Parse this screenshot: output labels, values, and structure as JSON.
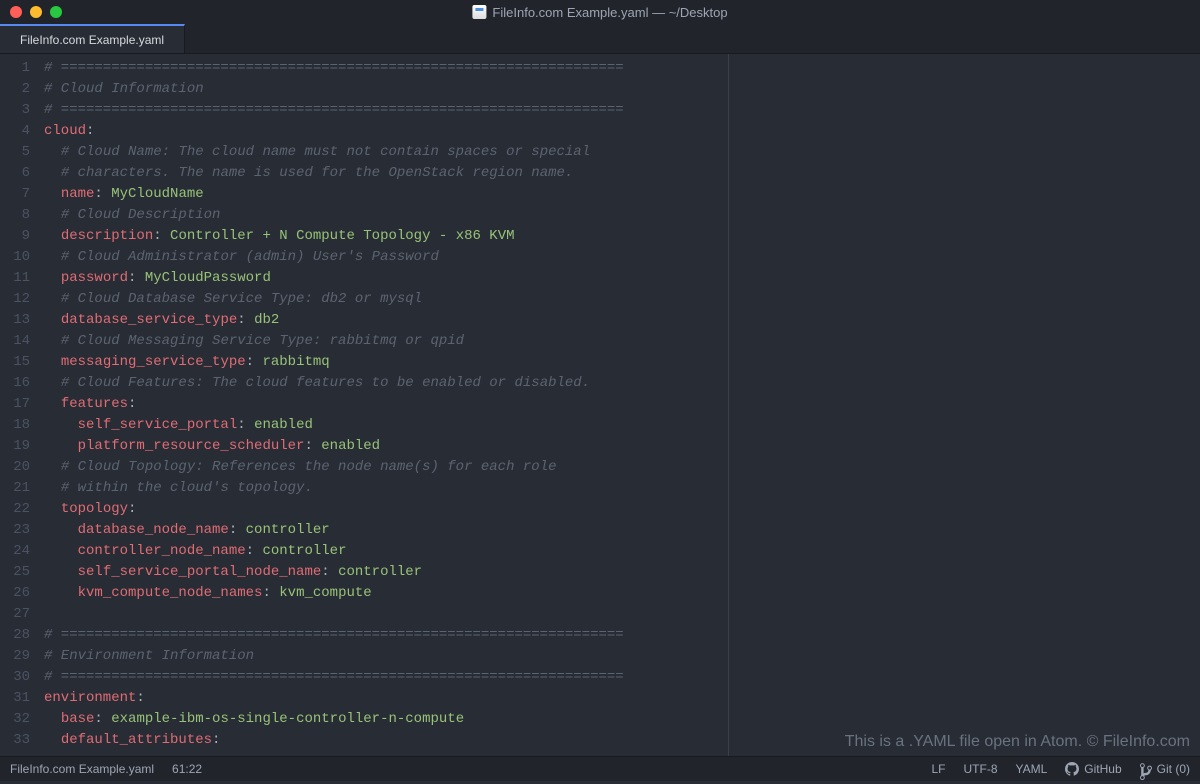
{
  "titlebar": {
    "title": "FileInfo.com Example.yaml — ~/Desktop"
  },
  "tab": {
    "label": "FileInfo.com Example.yaml"
  },
  "code": {
    "lines": [
      {
        "n": 1,
        "spans": [
          {
            "cls": "comment",
            "t": "# ==================================================================="
          }
        ]
      },
      {
        "n": 2,
        "spans": [
          {
            "cls": "comment",
            "t": "# Cloud Information"
          }
        ]
      },
      {
        "n": 3,
        "spans": [
          {
            "cls": "comment",
            "t": "# ==================================================================="
          }
        ]
      },
      {
        "n": 4,
        "spans": [
          {
            "cls": "key1",
            "t": "cloud"
          },
          {
            "cls": "colon",
            "t": ":"
          }
        ]
      },
      {
        "n": 5,
        "spans": [
          {
            "cls": "",
            "t": "  "
          },
          {
            "cls": "comment",
            "t": "# Cloud Name: The cloud name must not contain spaces or special"
          }
        ]
      },
      {
        "n": 6,
        "spans": [
          {
            "cls": "",
            "t": "  "
          },
          {
            "cls": "comment",
            "t": "# characters. The name is used for the OpenStack region name."
          }
        ]
      },
      {
        "n": 7,
        "spans": [
          {
            "cls": "",
            "t": "  "
          },
          {
            "cls": "key1",
            "t": "name"
          },
          {
            "cls": "colon",
            "t": ": "
          },
          {
            "cls": "string",
            "t": "MyCloudName"
          }
        ]
      },
      {
        "n": 8,
        "spans": [
          {
            "cls": "",
            "t": "  "
          },
          {
            "cls": "comment",
            "t": "# Cloud Description"
          }
        ]
      },
      {
        "n": 9,
        "spans": [
          {
            "cls": "",
            "t": "  "
          },
          {
            "cls": "key1",
            "t": "description"
          },
          {
            "cls": "colon",
            "t": ": "
          },
          {
            "cls": "string",
            "t": "Controller + N Compute Topology - x86 KVM"
          }
        ]
      },
      {
        "n": 10,
        "spans": [
          {
            "cls": "",
            "t": "  "
          },
          {
            "cls": "comment",
            "t": "# Cloud Administrator (admin) User's Password"
          }
        ]
      },
      {
        "n": 11,
        "spans": [
          {
            "cls": "",
            "t": "  "
          },
          {
            "cls": "key1",
            "t": "password"
          },
          {
            "cls": "colon",
            "t": ": "
          },
          {
            "cls": "string",
            "t": "MyCloudPassword"
          }
        ]
      },
      {
        "n": 12,
        "spans": [
          {
            "cls": "",
            "t": "  "
          },
          {
            "cls": "comment",
            "t": "# Cloud Database Service Type: db2 or mysql"
          }
        ]
      },
      {
        "n": 13,
        "spans": [
          {
            "cls": "",
            "t": "  "
          },
          {
            "cls": "key1",
            "t": "database_service_type"
          },
          {
            "cls": "colon",
            "t": ": "
          },
          {
            "cls": "string",
            "t": "db2"
          }
        ]
      },
      {
        "n": 14,
        "spans": [
          {
            "cls": "",
            "t": "  "
          },
          {
            "cls": "comment",
            "t": "# Cloud Messaging Service Type: rabbitmq or qpid"
          }
        ]
      },
      {
        "n": 15,
        "spans": [
          {
            "cls": "",
            "t": "  "
          },
          {
            "cls": "key1",
            "t": "messaging_service_type"
          },
          {
            "cls": "colon",
            "t": ": "
          },
          {
            "cls": "string",
            "t": "rabbitmq"
          }
        ]
      },
      {
        "n": 16,
        "spans": [
          {
            "cls": "",
            "t": "  "
          },
          {
            "cls": "comment",
            "t": "# Cloud Features: The cloud features to be enabled or disabled."
          }
        ]
      },
      {
        "n": 17,
        "spans": [
          {
            "cls": "",
            "t": "  "
          },
          {
            "cls": "key1",
            "t": "features"
          },
          {
            "cls": "colon",
            "t": ":"
          }
        ]
      },
      {
        "n": 18,
        "spans": [
          {
            "cls": "",
            "t": "    "
          },
          {
            "cls": "key1",
            "t": "self_service_portal"
          },
          {
            "cls": "colon",
            "t": ": "
          },
          {
            "cls": "string",
            "t": "enabled"
          }
        ]
      },
      {
        "n": 19,
        "spans": [
          {
            "cls": "",
            "t": "    "
          },
          {
            "cls": "key1",
            "t": "platform_resource_scheduler"
          },
          {
            "cls": "colon",
            "t": ": "
          },
          {
            "cls": "string",
            "t": "enabled"
          }
        ]
      },
      {
        "n": 20,
        "spans": [
          {
            "cls": "",
            "t": "  "
          },
          {
            "cls": "comment",
            "t": "# Cloud Topology: References the node name(s) for each role"
          }
        ]
      },
      {
        "n": 21,
        "spans": [
          {
            "cls": "",
            "t": "  "
          },
          {
            "cls": "comment",
            "t": "# within the cloud's topology."
          }
        ]
      },
      {
        "n": 22,
        "spans": [
          {
            "cls": "",
            "t": "  "
          },
          {
            "cls": "key1",
            "t": "topology"
          },
          {
            "cls": "colon",
            "t": ":"
          }
        ]
      },
      {
        "n": 23,
        "spans": [
          {
            "cls": "",
            "t": "    "
          },
          {
            "cls": "key1",
            "t": "database_node_name"
          },
          {
            "cls": "colon",
            "t": ": "
          },
          {
            "cls": "string",
            "t": "controller"
          }
        ]
      },
      {
        "n": 24,
        "spans": [
          {
            "cls": "",
            "t": "    "
          },
          {
            "cls": "key1",
            "t": "controller_node_name"
          },
          {
            "cls": "colon",
            "t": ": "
          },
          {
            "cls": "string",
            "t": "controller"
          }
        ]
      },
      {
        "n": 25,
        "spans": [
          {
            "cls": "",
            "t": "    "
          },
          {
            "cls": "key1",
            "t": "self_service_portal_node_name"
          },
          {
            "cls": "colon",
            "t": ": "
          },
          {
            "cls": "string",
            "t": "controller"
          }
        ]
      },
      {
        "n": 26,
        "spans": [
          {
            "cls": "",
            "t": "    "
          },
          {
            "cls": "key1",
            "t": "kvm_compute_node_names"
          },
          {
            "cls": "colon",
            "t": ": "
          },
          {
            "cls": "string",
            "t": "kvm_compute"
          }
        ]
      },
      {
        "n": 27,
        "spans": []
      },
      {
        "n": 28,
        "spans": [
          {
            "cls": "comment",
            "t": "# ==================================================================="
          }
        ]
      },
      {
        "n": 29,
        "spans": [
          {
            "cls": "comment",
            "t": "# Environment Information"
          }
        ]
      },
      {
        "n": 30,
        "spans": [
          {
            "cls": "comment",
            "t": "# ==================================================================="
          }
        ]
      },
      {
        "n": 31,
        "spans": [
          {
            "cls": "key1",
            "t": "environment"
          },
          {
            "cls": "colon",
            "t": ":"
          }
        ]
      },
      {
        "n": 32,
        "spans": [
          {
            "cls": "",
            "t": "  "
          },
          {
            "cls": "key1",
            "t": "base"
          },
          {
            "cls": "colon",
            "t": ": "
          },
          {
            "cls": "string",
            "t": "example-ibm-os-single-controller-n-compute"
          }
        ]
      },
      {
        "n": 33,
        "spans": [
          {
            "cls": "",
            "t": "  "
          },
          {
            "cls": "key1",
            "t": "default_attributes"
          },
          {
            "cls": "colon",
            "t": ":"
          }
        ]
      }
    ]
  },
  "statusbar": {
    "filename": "FileInfo.com Example.yaml",
    "cursor": "61:22",
    "line_ending": "LF",
    "encoding": "UTF-8",
    "grammar": "YAML",
    "github": "GitHub",
    "git": "Git (0)"
  },
  "watermark": "This is a .YAML file open in Atom. © FileInfo.com"
}
